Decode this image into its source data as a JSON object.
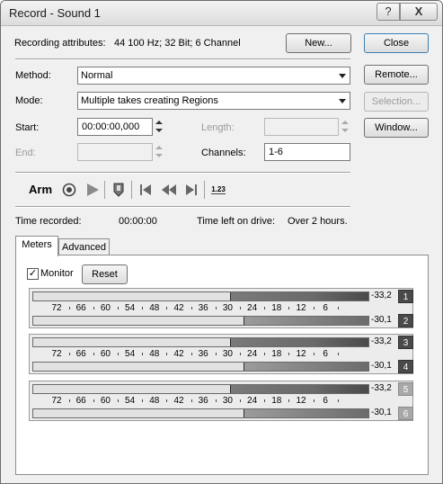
{
  "window": {
    "title": "Record - Sound 1",
    "help_glyph": "?",
    "close_glyph": "X"
  },
  "attributes": {
    "label": "Recording attributes:",
    "value": "44 100 Hz; 32 Bit; 6 Channel"
  },
  "buttons": {
    "new": "New...",
    "close": "Close",
    "remote": "Remote...",
    "selection": "Selection...",
    "window": "Window...",
    "reset": "Reset"
  },
  "method": {
    "label": "Method:",
    "value": "Normal"
  },
  "mode": {
    "label": "Mode:",
    "value": "Multiple takes creating Regions"
  },
  "start": {
    "label": "Start:",
    "value": "00:00:00,000"
  },
  "end": {
    "label": "End:",
    "value": ""
  },
  "length": {
    "label": "Length:",
    "value": ""
  },
  "channels": {
    "label": "Channels:",
    "value": "1-6"
  },
  "transport": {
    "arm_label": "Arm",
    "icons": [
      "record-icon",
      "play-icon",
      "marker-icon",
      "go-to-start-icon",
      "rewind-icon",
      "go-to-end-icon",
      "counter-icon"
    ],
    "counter_glyph": "1.23"
  },
  "status": {
    "time_recorded_label": "Time recorded:",
    "time_recorded_value": "00:00:00",
    "time_left_label": "Time left on drive:",
    "time_left_value": "Over 2 hours."
  },
  "tabs": [
    {
      "label": "Meters",
      "active": true
    },
    {
      "label": "Advanced",
      "active": false
    }
  ],
  "meters": {
    "monitor_label": "Monitor",
    "monitor_checked": true,
    "check_glyph": "✓",
    "scale": [
      "72",
      "66",
      "60",
      "54",
      "48",
      "42",
      "36",
      "30",
      "24",
      "18",
      "12",
      "6"
    ],
    "channels": [
      {
        "number": "1",
        "peak": "-33,2",
        "level": 0.41,
        "enabled": true
      },
      {
        "number": "2",
        "peak": "-30,1",
        "level": 0.37,
        "enabled": true
      },
      {
        "number": "3",
        "peak": "-33,2",
        "level": 0.41,
        "enabled": true
      },
      {
        "number": "4",
        "peak": "-30,1",
        "level": 0.37,
        "enabled": true
      },
      {
        "number": "5",
        "peak": "-33,2",
        "level": 0.41,
        "enabled": false
      },
      {
        "number": "6",
        "peak": "-30,1",
        "level": 0.37,
        "enabled": false
      }
    ]
  },
  "colors": {
    "channel_enabled": "#4a4a4a",
    "channel_disabled": "#a8a8a8"
  }
}
